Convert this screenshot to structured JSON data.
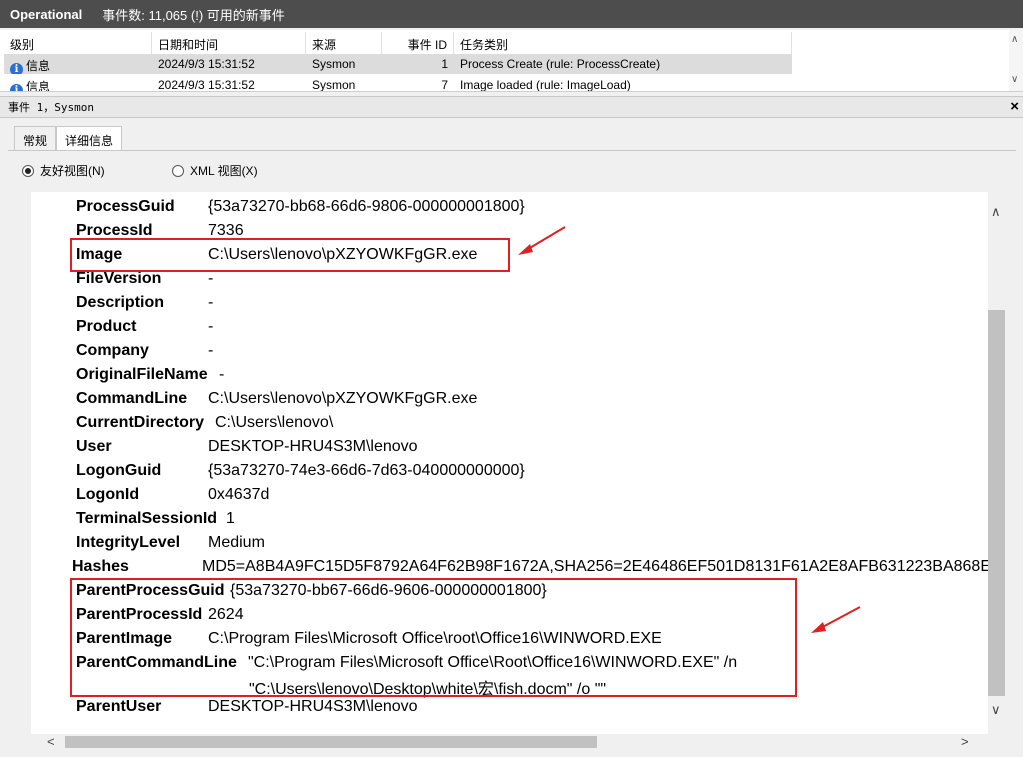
{
  "titlebar": {
    "log_name": "Operational",
    "event_count": "事件数: 11,065 (!) 可用的新事件"
  },
  "list": {
    "columns": [
      "级别",
      "日期和时间",
      "来源",
      "事件 ID",
      "任务类别"
    ],
    "rows": [
      {
        "level": "信息",
        "datetime": "2024/9/3 15:31:52",
        "source": "Sysmon",
        "event_id": "1",
        "task": "Process Create (rule: ProcessCreate)"
      },
      {
        "level": "信息",
        "datetime": "2024/9/3 15:31:52",
        "source": "Sysmon",
        "event_id": "7",
        "task": "Image loaded (rule: ImageLoad)"
      }
    ]
  },
  "detail_header": {
    "label": "事件 1，Sysmon",
    "close": "×"
  },
  "tabs": [
    "常规",
    "详细信息"
  ],
  "view_options": {
    "friendly": "友好视图(N)",
    "xml": "XML 视图(X)"
  },
  "fields": [
    {
      "key": "ProcessGuid",
      "value": "{53a73270-bb68-66d6-9806-000000001800}"
    },
    {
      "key": "ProcessId",
      "value": "7336"
    },
    {
      "key": "Image",
      "value": "C:\\Users\\lenovo\\pXZYOWKFgGR.exe"
    },
    {
      "key": "FileVersion",
      "value": "-"
    },
    {
      "key": "Description",
      "value": "-"
    },
    {
      "key": "Product",
      "value": "-"
    },
    {
      "key": "Company",
      "value": "-"
    },
    {
      "key": "OriginalFileName",
      "value": "-"
    },
    {
      "key": "CommandLine",
      "value": "C:\\Users\\lenovo\\pXZYOWKFgGR.exe"
    },
    {
      "key": "CurrentDirectory",
      "value": "C:\\Users\\lenovo\\"
    },
    {
      "key": "User",
      "value": "DESKTOP-HRU4S3M\\lenovo"
    },
    {
      "key": "LogonGuid",
      "value": "{53a73270-74e3-66d6-7d63-040000000000}"
    },
    {
      "key": "LogonId",
      "value": "0x4637d"
    },
    {
      "key": "TerminalSessionId",
      "value": "1"
    },
    {
      "key": "IntegrityLevel",
      "value": "Medium"
    },
    {
      "key": "Hashes",
      "value": "MD5=A8B4A9FC15D5F8792A64F62B98F1672A,SHA256=2E46486EF501D8131F61A2E8AFB631223BA868E"
    },
    {
      "key": "ParentProcessGuid",
      "value": "{53a73270-bb67-66d6-9606-000000001800}"
    },
    {
      "key": "ParentProcessId",
      "value": "2624"
    },
    {
      "key": "ParentImage",
      "value": "C:\\Program Files\\Microsoft Office\\root\\Office16\\WINWORD.EXE"
    },
    {
      "key": "ParentCommandLine",
      "value": "\"C:\\Program Files\\Microsoft Office\\Root\\Office16\\WINWORD.EXE\" /n",
      "value2": "\"C:\\Users\\lenovo\\Desktop\\white\\宏\\fish.docm\" /o \"\""
    },
    {
      "key": "ParentUser",
      "value": "DESKTOP-HRU4S3M\\lenovo"
    }
  ],
  "colors": {
    "highlight": "#e02020",
    "titlebar": "#4d4d4d",
    "info": "#2a6ed6"
  }
}
